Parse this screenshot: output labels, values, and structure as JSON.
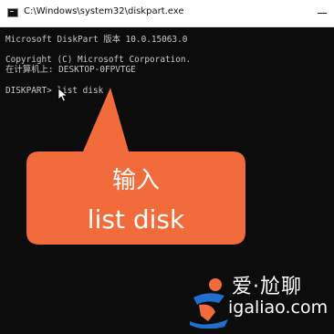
{
  "window": {
    "title": "C:\\Windows\\system32\\diskpart.exe"
  },
  "console": {
    "line1": "Microsoft DiskPart 版本 10.0.15063.0",
    "line2": "Copyright (C) Microsoft Corporation.",
    "line3": "在计算机上: DESKTOP-0FPVTGE",
    "prompt": "DISKPART> ",
    "command": "list disk"
  },
  "callout": {
    "line1": "输入",
    "line2": "list disk",
    "color": "#f26b3a"
  },
  "watermark": {
    "top": "爱·尬聊",
    "bottom": "igaliao.com"
  },
  "colors": {
    "console_bg": "#0c0c0c",
    "console_text": "#c8c8c8",
    "titlebar_bg": "#ffffff"
  }
}
